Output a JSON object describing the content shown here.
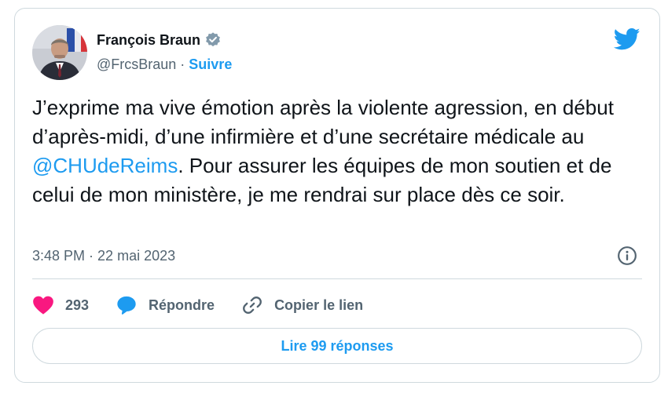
{
  "author": {
    "name": "François Braun",
    "handle": "@FrcsBraun",
    "separator": "·",
    "follow_label": "Suivre"
  },
  "tweet": {
    "text_part1": "J’exprime ma vive émotion après la violente agression, en début d’après-midi, d’une infirmière et d’une secrétaire médicale au ",
    "mention": "@CHUdeReims",
    "text_part2": ". Pour assurer les équipes de mon soutien et de celui de mon ministère, je me rendrai sur place dès ce soir.",
    "time": "3:48 PM",
    "date_separator": "·",
    "date": "22 mai 2023"
  },
  "actions": {
    "like_count": "293",
    "reply_label": "Répondre",
    "copy_link_label": "Copier le lien"
  },
  "read_replies_label": "Lire 99 réponses",
  "icons": {
    "like": "heart-icon",
    "reply": "speech-bubble-icon",
    "copy": "link-icon",
    "info": "info-icon",
    "brand": "twitter-bird-icon",
    "verified": "verified-badge-icon"
  },
  "colors": {
    "accent": "#1d9bf0",
    "like": "#f91880",
    "text": "#0f1419",
    "muted": "#536471",
    "border": "#cfd9de"
  }
}
